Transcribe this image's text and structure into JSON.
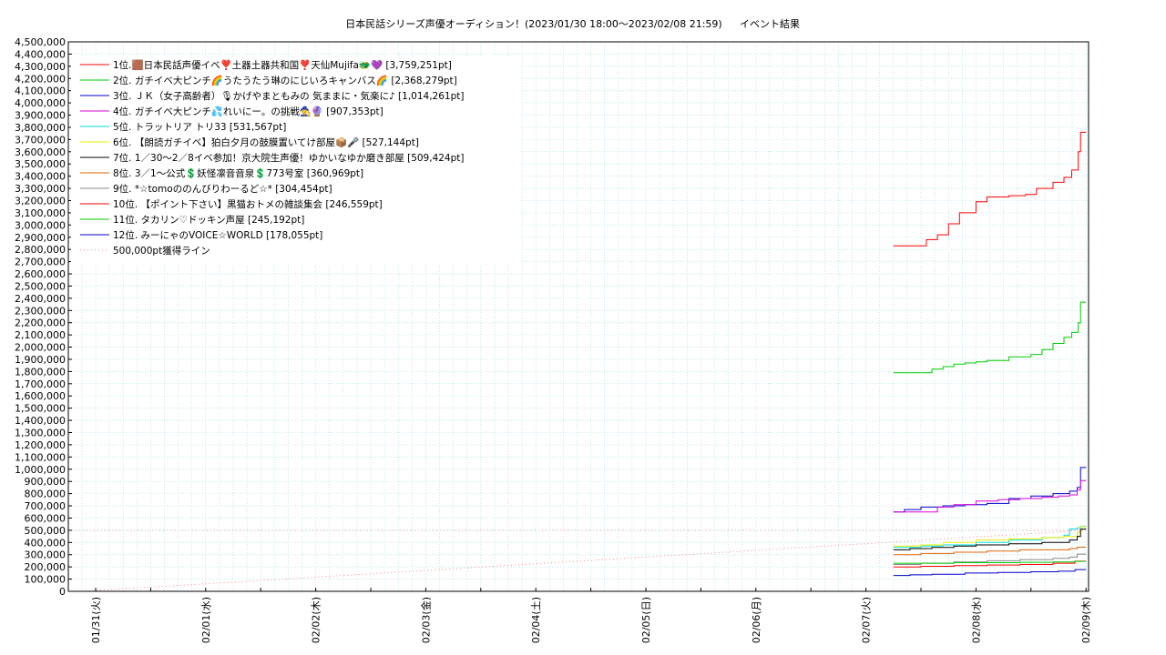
{
  "page": {
    "title": "日本民話シリーズ声優オーディション！(2023/01/30 18:00〜2023/02/08 21:59)",
    "subtitle": "イベント結果"
  },
  "chart_data": {
    "type": "line",
    "title": "日本民話シリーズ声優オーディション！(2023/01/30 18:00〜2023/02/08 21:59)",
    "subtitle": "イベント結果",
    "xlabel": "",
    "ylabel": "",
    "x_ticks": [
      "01/31(火)",
      "02/01(水)",
      "02/02(木)",
      "02/03(金)",
      "02/04(土)",
      "02/05(日)",
      "02/06(月)",
      "02/07(火)",
      "02/08(水)",
      "02/09(木)"
    ],
    "x_range": [
      "01/30(月) 21:00",
      "02/09(木) 01:00"
    ],
    "ylim": [
      0,
      4500000
    ],
    "y_tick_step": 100000,
    "grid": true,
    "legend_position": "top-left",
    "series": [
      {
        "name": "1位.🟫日本民話声優イベ❣️土器土器共和国❣️天仙Mujifa🐲💜 [3,759,251pt]",
        "color": "#ff0000",
        "x": [
          7.25,
          7.45,
          7.55,
          7.65,
          7.75,
          7.85,
          8.0,
          8.1,
          8.15,
          8.2,
          8.3,
          8.45,
          8.55,
          8.7,
          8.8,
          8.87,
          8.93,
          8.95,
          9.0
        ],
        "y": [
          2830000,
          2830000,
          2880000,
          2920000,
          3010000,
          3100000,
          3190000,
          3230000,
          3230000,
          3230000,
          3240000,
          3250000,
          3300000,
          3350000,
          3390000,
          3450000,
          3600000,
          3759251,
          3759251
        ]
      },
      {
        "name": "2位. ガチイベ大ピンチ🌈うたうたう琳のにじいろキャンバス🌈 [2,368,279pt]",
        "color": "#00cc00",
        "x": [
          7.25,
          7.5,
          7.6,
          7.7,
          7.8,
          7.9,
          8.0,
          8.1,
          8.3,
          8.5,
          8.6,
          8.7,
          8.8,
          8.87,
          8.93,
          8.95,
          9.0
        ],
        "y": [
          1790000,
          1790000,
          1820000,
          1840000,
          1860000,
          1870000,
          1880000,
          1890000,
          1920000,
          1940000,
          1980000,
          2030000,
          2080000,
          2120000,
          2200000,
          2368279,
          2368279
        ]
      },
      {
        "name": "3位. ＪＫ（女子高齢者）🎙かげやまともみの 気ままに・気楽に♪ [1,014,261pt]",
        "color": "#0000cc",
        "x": [
          7.25,
          7.35,
          7.5,
          7.7,
          7.9,
          8.1,
          8.3,
          8.5,
          8.7,
          8.85,
          8.92,
          8.95,
          9.0
        ],
        "y": [
          650000,
          670000,
          690000,
          700000,
          710000,
          720000,
          760000,
          780000,
          800000,
          820000,
          850000,
          1014261,
          1014261
        ]
      },
      {
        "name": "4位. ガチイベ大ピンチ💦れいにー。の挑戦🧙🔮 [907,353pt]",
        "color": "#dd00dd",
        "x": [
          7.25,
          7.5,
          7.65,
          7.8,
          8.0,
          8.2,
          8.4,
          8.6,
          8.75,
          8.85,
          8.92,
          8.95,
          9.0
        ],
        "y": [
          650000,
          650000,
          690000,
          710000,
          740000,
          750000,
          760000,
          770000,
          780000,
          790000,
          830000,
          907353,
          907353
        ]
      },
      {
        "name": "5位. トラットリア トリ33 [531,567pt]",
        "color": "#00dddd",
        "x": [
          7.25,
          7.5,
          7.7,
          8.0,
          8.3,
          8.6,
          8.8,
          8.85,
          8.92,
          8.95,
          9.0
        ],
        "y": [
          360000,
          370000,
          380000,
          400000,
          420000,
          440000,
          460000,
          510000,
          520000,
          531567,
          531567
        ]
      },
      {
        "name": "6位. 【朗読ガチイベ】狛白夕月の鼓膜置いてけ部屋📦🎤 [527,144pt]",
        "color": "#eeee00",
        "x": [
          7.25,
          7.5,
          7.7,
          8.0,
          8.3,
          8.6,
          8.8,
          8.92,
          8.95,
          9.0
        ],
        "y": [
          370000,
          380000,
          400000,
          420000,
          430000,
          440000,
          450000,
          480000,
          527144,
          527144
        ]
      },
      {
        "name": "7位. 1／30〜2／8イベ参加！京大院生声優！ゆかいなゆか磨き部屋 [509,424pt]",
        "color": "#000000",
        "x": [
          7.25,
          7.4,
          7.6,
          7.8,
          8.0,
          8.3,
          8.6,
          8.85,
          8.92,
          8.95,
          9.0
        ],
        "y": [
          340000,
          350000,
          360000,
          370000,
          380000,
          390000,
          400000,
          420000,
          450000,
          509424,
          509424
        ]
      },
      {
        "name": "8位. 3／1〜公式💲妖怪凛音音泉💲773号室 [360,969pt]",
        "color": "#dd6600",
        "x": [
          7.25,
          7.5,
          7.8,
          8.1,
          8.4,
          8.7,
          8.85,
          8.92,
          9.0
        ],
        "y": [
          300000,
          310000,
          320000,
          330000,
          340000,
          340000,
          350000,
          360969,
          360969
        ]
      },
      {
        "name": "9位. *☆tomoののんびりわーるど☆* [304,454pt]",
        "color": "#888888",
        "x": [
          7.25,
          7.5,
          7.8,
          8.1,
          8.4,
          8.7,
          8.85,
          8.92,
          9.0
        ],
        "y": [
          220000,
          230000,
          240000,
          250000,
          260000,
          270000,
          280000,
          304454,
          304454
        ]
      },
      {
        "name": "10位. 【ポイント下さい】黒猫おトメの雑談集会 [246,559pt]",
        "color": "#ff0000",
        "x": [
          7.25,
          7.5,
          7.8,
          8.1,
          8.4,
          8.7,
          8.9,
          9.0
        ],
        "y": [
          200000,
          205000,
          210000,
          215000,
          220000,
          230000,
          246559,
          246559
        ]
      },
      {
        "name": "11位. タカリン♡ドッキン声屋 [245,192pt]",
        "color": "#00cc00",
        "x": [
          7.25,
          7.5,
          7.8,
          8.1,
          8.4,
          8.7,
          8.9,
          9.0
        ],
        "y": [
          230000,
          230000,
          235000,
          235000,
          238000,
          240000,
          245192,
          245192
        ]
      },
      {
        "name": "12位. みーにゃのVOICE☆WORLD [178,055pt]",
        "color": "#0000cc",
        "x": [
          7.25,
          7.4,
          7.6,
          7.9,
          8.2,
          8.5,
          8.75,
          8.9,
          9.0
        ],
        "y": [
          130000,
          135000,
          140000,
          150000,
          155000,
          160000,
          165000,
          178055,
          178055
        ]
      },
      {
        "name": "500,000pt獲得ライン",
        "color": "#ff8888",
        "dotted": true,
        "x": [
          -0.125,
          9.0
        ],
        "y": [
          0,
          500000
        ]
      }
    ]
  }
}
